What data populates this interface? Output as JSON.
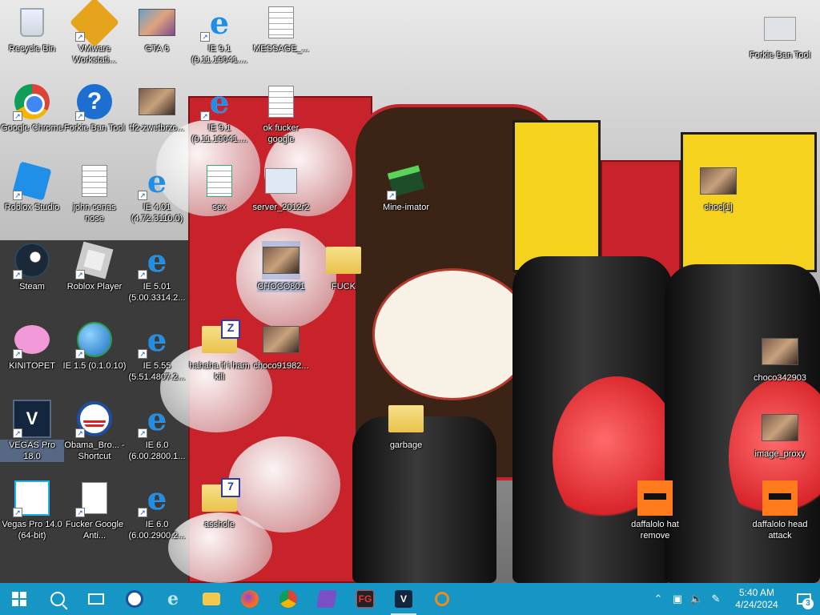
{
  "desktop": {
    "icons": [
      {
        "label": "Recycle Bin",
        "icon": "recycle-bin-icon"
      },
      {
        "label": "VMware Workstati...",
        "icon": "vmware-icon"
      },
      {
        "label": "GTA 6",
        "icon": "gta6-thumbnail-icon"
      },
      {
        "label": "IE 9.1 (9.11.19041....",
        "icon": "internet-explorer-icon"
      },
      {
        "label": "MESSAGE_...",
        "icon": "text-document-icon"
      },
      {
        "label": "Forkie Ban Tool",
        "icon": "app-settings-icon"
      },
      {
        "label": "Google Chrome",
        "icon": "chrome-icon"
      },
      {
        "label": "Forkie Ban Tool",
        "icon": "help-icon"
      },
      {
        "label": "tf2-zwetbrzc...",
        "icon": "image-thumbnail-icon"
      },
      {
        "label": "IE 9.1 (9.11.19041....",
        "icon": "internet-explorer-icon"
      },
      {
        "label": "ok fucker google",
        "icon": "text-document-icon"
      },
      {
        "label": "Roblox Studio",
        "icon": "roblox-studio-icon"
      },
      {
        "label": "john cenas nose",
        "icon": "text-document-icon"
      },
      {
        "label": "IE 4.01 (4.72.3110.0)",
        "icon": "internet-explorer-icon"
      },
      {
        "label": "sex",
        "icon": "script-file-icon"
      },
      {
        "label": "server_2012r2",
        "icon": "remote-desktop-icon"
      },
      {
        "label": "Mine-imator",
        "icon": "mine-imator-icon"
      },
      {
        "label": "choc[1]",
        "icon": "image-thumbnail-icon"
      },
      {
        "label": "Steam",
        "icon": "steam-icon"
      },
      {
        "label": "Roblox Player",
        "icon": "roblox-icon"
      },
      {
        "label": "IE 5.01 (5.00.3314.2...",
        "icon": "internet-explorer-icon"
      },
      {
        "label": "CHOCO801",
        "icon": "image-thumbnail-icon"
      },
      {
        "label": "FUCK",
        "icon": "folder-icon"
      },
      {
        "label": "KINITOPET",
        "icon": "kinitopet-icon"
      },
      {
        "label": "IE 1.5 (0.1.0.10)",
        "icon": "internet-explorer-globe-icon"
      },
      {
        "label": "IE 5.55 (5.51.4807.2...",
        "icon": "internet-explorer-icon"
      },
      {
        "label": "hahaha if i ham kill",
        "icon": "zip-folder-icon"
      },
      {
        "label": "choco91982...",
        "icon": "image-thumbnail-icon"
      },
      {
        "label": "choco342903",
        "icon": "image-thumbnail-icon"
      },
      {
        "label": "VEGAS Pro 18.0",
        "icon": "vegas-pro-icon"
      },
      {
        "label": "Obama_Bro... - Shortcut",
        "icon": "obama-logo-icon"
      },
      {
        "label": "IE 6.0 (6.00.2800.1...",
        "icon": "internet-explorer-icon"
      },
      {
        "label": "garbage",
        "icon": "folder-icon"
      },
      {
        "label": "image_proxy",
        "icon": "image-thumbnail-icon"
      },
      {
        "label": "Vegas Pro 14.0 (64-bit)",
        "icon": "vegas-pro-14-icon"
      },
      {
        "label": "Fucker Google Anti...",
        "icon": "blank-document-icon"
      },
      {
        "label": "IE 6.0 (6.00.2900.2...",
        "icon": "internet-explorer-icon"
      },
      {
        "label": "asshole",
        "icon": "7zip-folder-icon"
      },
      {
        "label": "daffalolo hat remove",
        "icon": "daffalolo-icon"
      },
      {
        "label": "daffalolo head attack",
        "icon": "daffalolo-icon"
      }
    ]
  },
  "taskbar": {
    "pinned": [
      {
        "name": "start-button",
        "icon": "windows-icon"
      },
      {
        "name": "search-button",
        "icon": "search-icon"
      },
      {
        "name": "task-view-button",
        "icon": "task-view-icon"
      },
      {
        "name": "obama-app",
        "icon": "obama-logo-icon"
      },
      {
        "name": "ie-app",
        "icon": "internet-explorer-icon"
      },
      {
        "name": "explorer-app",
        "icon": "folder-icon"
      },
      {
        "name": "firefox-app",
        "icon": "firefox-icon"
      },
      {
        "name": "chrome-app",
        "icon": "chrome-icon"
      },
      {
        "name": "visual-studio-app",
        "icon": "visual-studio-icon"
      },
      {
        "name": "fg-app",
        "icon": "fg-icon",
        "text": "FG"
      },
      {
        "name": "vegas-app",
        "icon": "vegas-pro-icon",
        "text": "V"
      },
      {
        "name": "magnifier-app",
        "icon": "magnifier-icon"
      }
    ],
    "tray": {
      "time": "5:40 AM",
      "date": "4/24/2024",
      "notification_count": "3"
    }
  },
  "colors": {
    "taskbar": "#1596c4",
    "ie_blue": "#1e8ee6"
  }
}
